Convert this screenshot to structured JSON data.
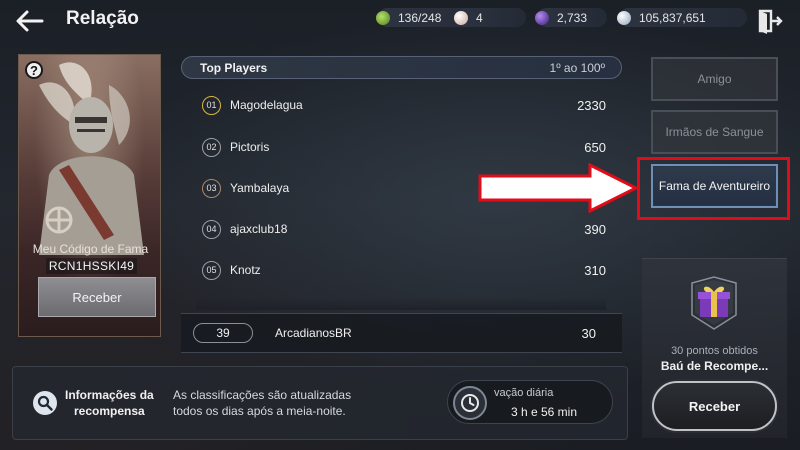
{
  "header": {
    "title": "Relação",
    "resources": [
      {
        "icon": "green-gem-icon",
        "value": "136/248",
        "color": "#7fb03a"
      },
      {
        "icon": "pearl-icon",
        "value": "4",
        "color": "#d9c2b8"
      },
      {
        "icon": "purple-orb-icon",
        "value": "2,733",
        "color": "#6d3fb0"
      },
      {
        "icon": "silver-coin-icon",
        "value": "105,837,651",
        "color": "#c9d3dc"
      }
    ]
  },
  "fame_card": {
    "help": "?",
    "code_label": "Meu Código de Fama",
    "code_value": "RCN1HSSKI49",
    "receive_label": "Receber"
  },
  "ranking": {
    "header_title": "Top Players",
    "header_range": "1º ao 100º",
    "rows": [
      {
        "rank": "01",
        "name": "Magodelagua",
        "score": "2330",
        "badge_color": "#d9b640"
      },
      {
        "rank": "02",
        "name": "Pictoris",
        "score": "650",
        "badge_color": "#a9aeb6"
      },
      {
        "rank": "03",
        "name": "Yambalaya",
        "score": "",
        "badge_color": "#a8896a"
      },
      {
        "rank": "04",
        "name": "ajaxclub18",
        "score": "390",
        "badge_color": "#a9aeb6"
      },
      {
        "rank": "05",
        "name": "Knotz",
        "score": "310",
        "badge_color": "#a9aeb6"
      }
    ],
    "own": {
      "rank": "39",
      "name": "ArcadianosBR",
      "score": "30"
    }
  },
  "tabs": [
    {
      "label": "Amigo",
      "active": false
    },
    {
      "label": "Irmãos de Sangue",
      "active": false
    },
    {
      "label": "Fama de Aventureiro",
      "active": true
    }
  ],
  "reward": {
    "points_text": "30 pontos obtidos",
    "name": "Baú de Recompe...",
    "receive_label": "Receber"
  },
  "info": {
    "title_line1": "Informações da",
    "title_line2": "recompensa",
    "desc_line1": "As classificações são atualizadas",
    "desc_line2": "todos os dias após a meia-noite.",
    "timer_label": "vação diária",
    "timer_value": "3 h e 56 min"
  }
}
